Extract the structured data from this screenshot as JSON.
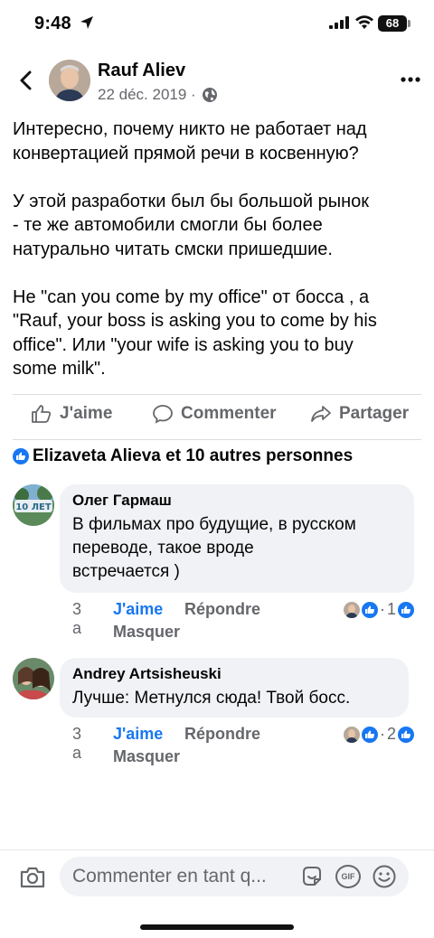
{
  "status_bar": {
    "time": "9:48",
    "battery": "68"
  },
  "post": {
    "author": "Rauf Aliev",
    "date": "22 déc. 2019 ·",
    "text": "Интересно, почему никто не работает над\nконвертацией прямой речи в косвенную?\n\nУ этой разработки был бы большой рынок\n- те же автомобили смогли бы более\nнатурально читать смски пришедшие.\n\nНе \"can you come by my office\" от босса , а\n\"Rauf, your boss is asking you to come by his\noffice\". Или \"your wife is asking you to buy\nsome milk\".",
    "actions": {
      "like": "J'aime",
      "comment": "Commenter",
      "share": "Partager"
    },
    "reactions_text": "Elizaveta Alieva et 10 autres personnes"
  },
  "comments": [
    {
      "author": "Олег Гармаш",
      "text": "В фильмах про будущие, в русском\nпереводе, такое вроде\nвстречается )",
      "time": "3 a",
      "like": "J'aime",
      "reply": "Répondre",
      "hide": "Masquer",
      "reaction_count": "1",
      "avatar_text": "10 ЛЕТ"
    },
    {
      "author": "Andrey Artsisheuski",
      "text": "Лучше: Метнулся сюда! Твой босс.",
      "time": "3 a",
      "like": "J'aime",
      "reply": "Répondre",
      "hide": "Masquer",
      "reaction_count": "2"
    }
  ],
  "composer": {
    "placeholder": "Commenter en tant q...",
    "gif_label": "GIF"
  },
  "colors": {
    "accent": "#1877f2",
    "muted_text": "#65676b",
    "bubble": "#f0f2f5"
  },
  "icons": [
    "back-arrow-icon",
    "globe-icon",
    "more-icon",
    "like-icon",
    "comment-icon",
    "share-icon",
    "like-reaction-icon",
    "camera-icon",
    "sticker-icon",
    "gif-icon",
    "emoji-icon"
  ]
}
